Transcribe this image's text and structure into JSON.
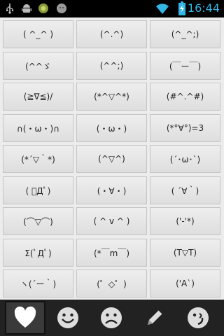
{
  "status_bar": {
    "time": "16:44",
    "icons": [
      "usb-icon",
      "android-debug-icon",
      "app-icon",
      "app-icon-2",
      "wifi-icon",
      "battery-charging-icon"
    ]
  },
  "emoticons": [
    [
      "( ^_^ )",
      "(^.^)",
      "(^_^;)"
    ],
    [
      "(^^ゞ",
      "(^^;)",
      "(￣ー￣)"
    ],
    [
      "(≧∇≦)/",
      "(*^▽^*)",
      "(#^.^#)"
    ],
    [
      "∩(・ω・)∩",
      "(・ω・)",
      "(*°∀°)=3"
    ],
    [
      "(*´▽｀*)",
      "(^▽^)",
      "(´･ω･`)"
    ],
    [
      "( ﾟДﾟ)",
      "(・∀・)",
      "( ´∀｀)"
    ],
    [
      "(⌒▽⌒)",
      "( ^ v ^ )",
      "('-'*)"
    ],
    [
      "Σ(ﾟДﾟ)",
      "(*￣m￣)",
      "(T▽T)"
    ],
    [
      "ヽ(´ー｀)",
      "(゜◇゜)",
      "('A`)"
    ]
  ],
  "tabs": [
    {
      "name": "tab-favorites",
      "icon": "heart-icon",
      "active": true
    },
    {
      "name": "tab-happy",
      "icon": "smiley-icon",
      "active": false
    },
    {
      "name": "tab-sad",
      "icon": "sad-face-icon",
      "active": false
    },
    {
      "name": "tab-edit",
      "icon": "pencil-icon",
      "active": false
    },
    {
      "name": "tab-other",
      "icon": "winking-face-icon",
      "active": false
    }
  ],
  "colors": {
    "time": "#33b5e5",
    "bottom_bar": "#222222",
    "cell_border": "#c4c4c4"
  }
}
